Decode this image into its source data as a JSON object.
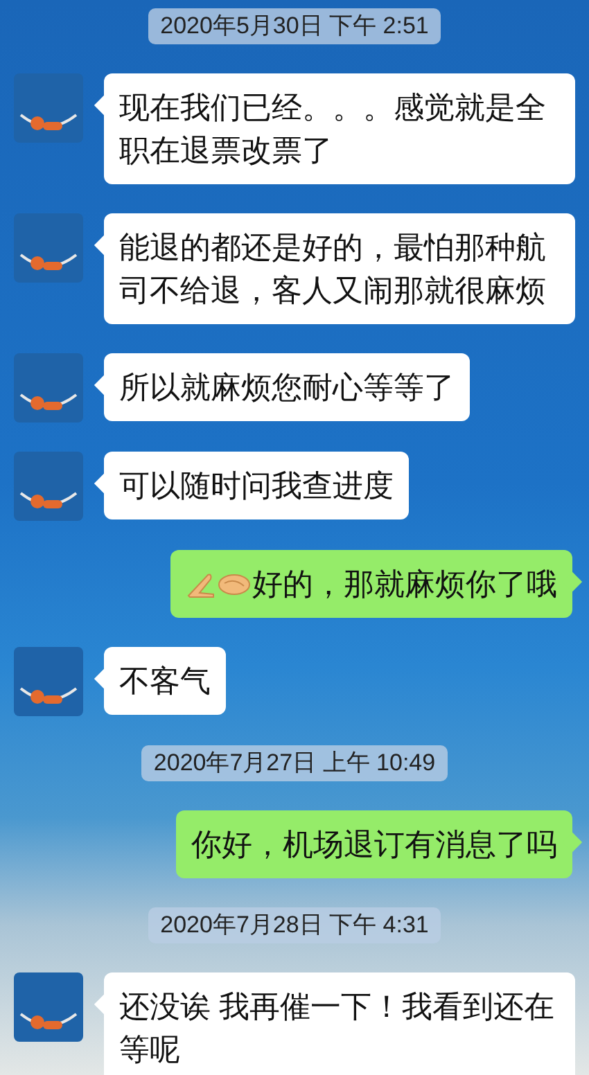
{
  "messages": [
    {
      "kind": "timestamp",
      "text": "2020年5月30日 下午 2:51"
    },
    {
      "kind": "incoming",
      "text": "现在我们已经。。。感觉就是全职在退票改票了"
    },
    {
      "kind": "incoming",
      "text": "能退的都还是好的，最怕那种航司不给退，客人又闹那就很麻烦"
    },
    {
      "kind": "incoming",
      "text": "所以就麻烦您耐心等等了"
    },
    {
      "kind": "incoming",
      "text": "可以随时问我查进度"
    },
    {
      "kind": "outgoing",
      "text": "好的，那就麻烦你了哦",
      "emoji_prefix": true
    },
    {
      "kind": "incoming",
      "text": "不客气"
    },
    {
      "kind": "timestamp",
      "text": "2020年7月27日 上午 10:49"
    },
    {
      "kind": "outgoing",
      "text": "你好，机场退订有消息了吗"
    },
    {
      "kind": "timestamp",
      "text": "2020年7月28日 下午 4:31"
    },
    {
      "kind": "incoming",
      "text": "还没诶 我再催一下！我看到还在等呢"
    }
  ]
}
